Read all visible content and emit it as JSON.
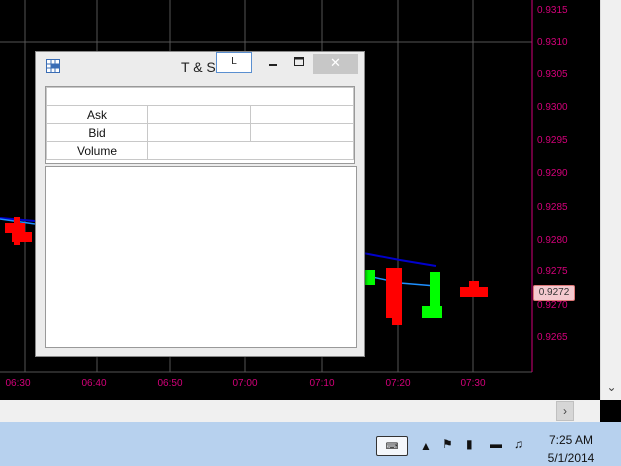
{
  "chart": {
    "price_ticks": [
      "0.9315",
      "0.9310",
      "0.9305",
      "0.9300",
      "0.9295",
      "0.9290",
      "0.9285",
      "0.9280",
      "0.9275",
      "0.9270",
      "0.9265"
    ],
    "time_ticks": [
      "06:30",
      "06:40",
      "06:50",
      "07:00",
      "07:10",
      "07:20",
      "07:30"
    ],
    "current_price": "0.9272",
    "colors": {
      "up": "#00ff00",
      "down": "#ff0000",
      "axis": "#d4007a",
      "grid": "#555555",
      "ma_fast": "#1e90ff",
      "ma_slow": "#0000cc"
    }
  },
  "ts_window": {
    "title": "T & S",
    "tab_label": "L",
    "minimize_icon": "minimize-icon",
    "maximize_icon": "maximize-icon",
    "close_icon": "close-icon",
    "quote_rows": [
      {
        "label": "",
        "col1": "",
        "col2": ""
      },
      {
        "label": "Ask",
        "col1": "",
        "col2": ""
      },
      {
        "label": "Bid",
        "col1": "",
        "col2": ""
      },
      {
        "label": "Volume",
        "col1": "",
        "col2": ""
      }
    ]
  },
  "taskbar": {
    "time": "7:25 AM",
    "date": "5/1/2014",
    "tray_icons": [
      "keyboard-icon",
      "show-hidden-icon",
      "action-center-icon",
      "power-icon",
      "signal-icon",
      "volume-icon"
    ]
  }
}
